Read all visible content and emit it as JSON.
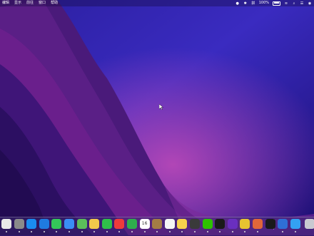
{
  "menubar": {
    "items": [
      "编辑",
      "显示",
      "前往",
      "窗口",
      "帮助"
    ],
    "battery_percent": "100%"
  },
  "dock": {
    "apps": [
      {
        "name": "finder-icon",
        "color": "#e9e9e9"
      },
      {
        "name": "system-preferences-icon",
        "color": "#8a8a8a"
      },
      {
        "name": "app-store-icon",
        "color": "#1a8cf0"
      },
      {
        "name": "safari-icon",
        "color": "#1f7be0"
      },
      {
        "name": "messages-icon",
        "color": "#34c759"
      },
      {
        "name": "mail-icon",
        "color": "#3a8ef5"
      },
      {
        "name": "maps-icon",
        "color": "#5bbd5a"
      },
      {
        "name": "photos-icon",
        "color": "#f2c84b"
      },
      {
        "name": "facetime-icon",
        "color": "#2fbf4a"
      },
      {
        "name": "wps-icon",
        "color": "#ef3b3b"
      },
      {
        "name": "numbers-icon",
        "color": "#2fae4d"
      },
      {
        "name": "calendar-icon",
        "color": "#ffffff"
      },
      {
        "name": "notes-brown-icon",
        "color": "#a37c45"
      },
      {
        "name": "reminders-icon",
        "color": "#f5f5f5"
      },
      {
        "name": "notes-icon",
        "color": "#f7d14c"
      },
      {
        "name": "calculator-icon",
        "color": "#3a3a3a"
      },
      {
        "name": "wechat-icon",
        "color": "#2dc100"
      },
      {
        "name": "qq-icon",
        "color": "#1a1a1a"
      },
      {
        "name": "video-editor-icon",
        "color": "#6a2fc0"
      },
      {
        "name": "stickies-icon",
        "color": "#e7c430"
      },
      {
        "name": "game-icon",
        "color": "#e0663a"
      },
      {
        "name": "capcut-icon",
        "color": "#1a1a1a"
      },
      {
        "name": "music-app-icon",
        "color": "#2f6fd6"
      },
      {
        "name": "video-player-icon",
        "color": "#33a1f2"
      },
      {
        "name": "trash-icon",
        "color": "#c9c9d1"
      }
    ],
    "calendar_day": "16"
  }
}
